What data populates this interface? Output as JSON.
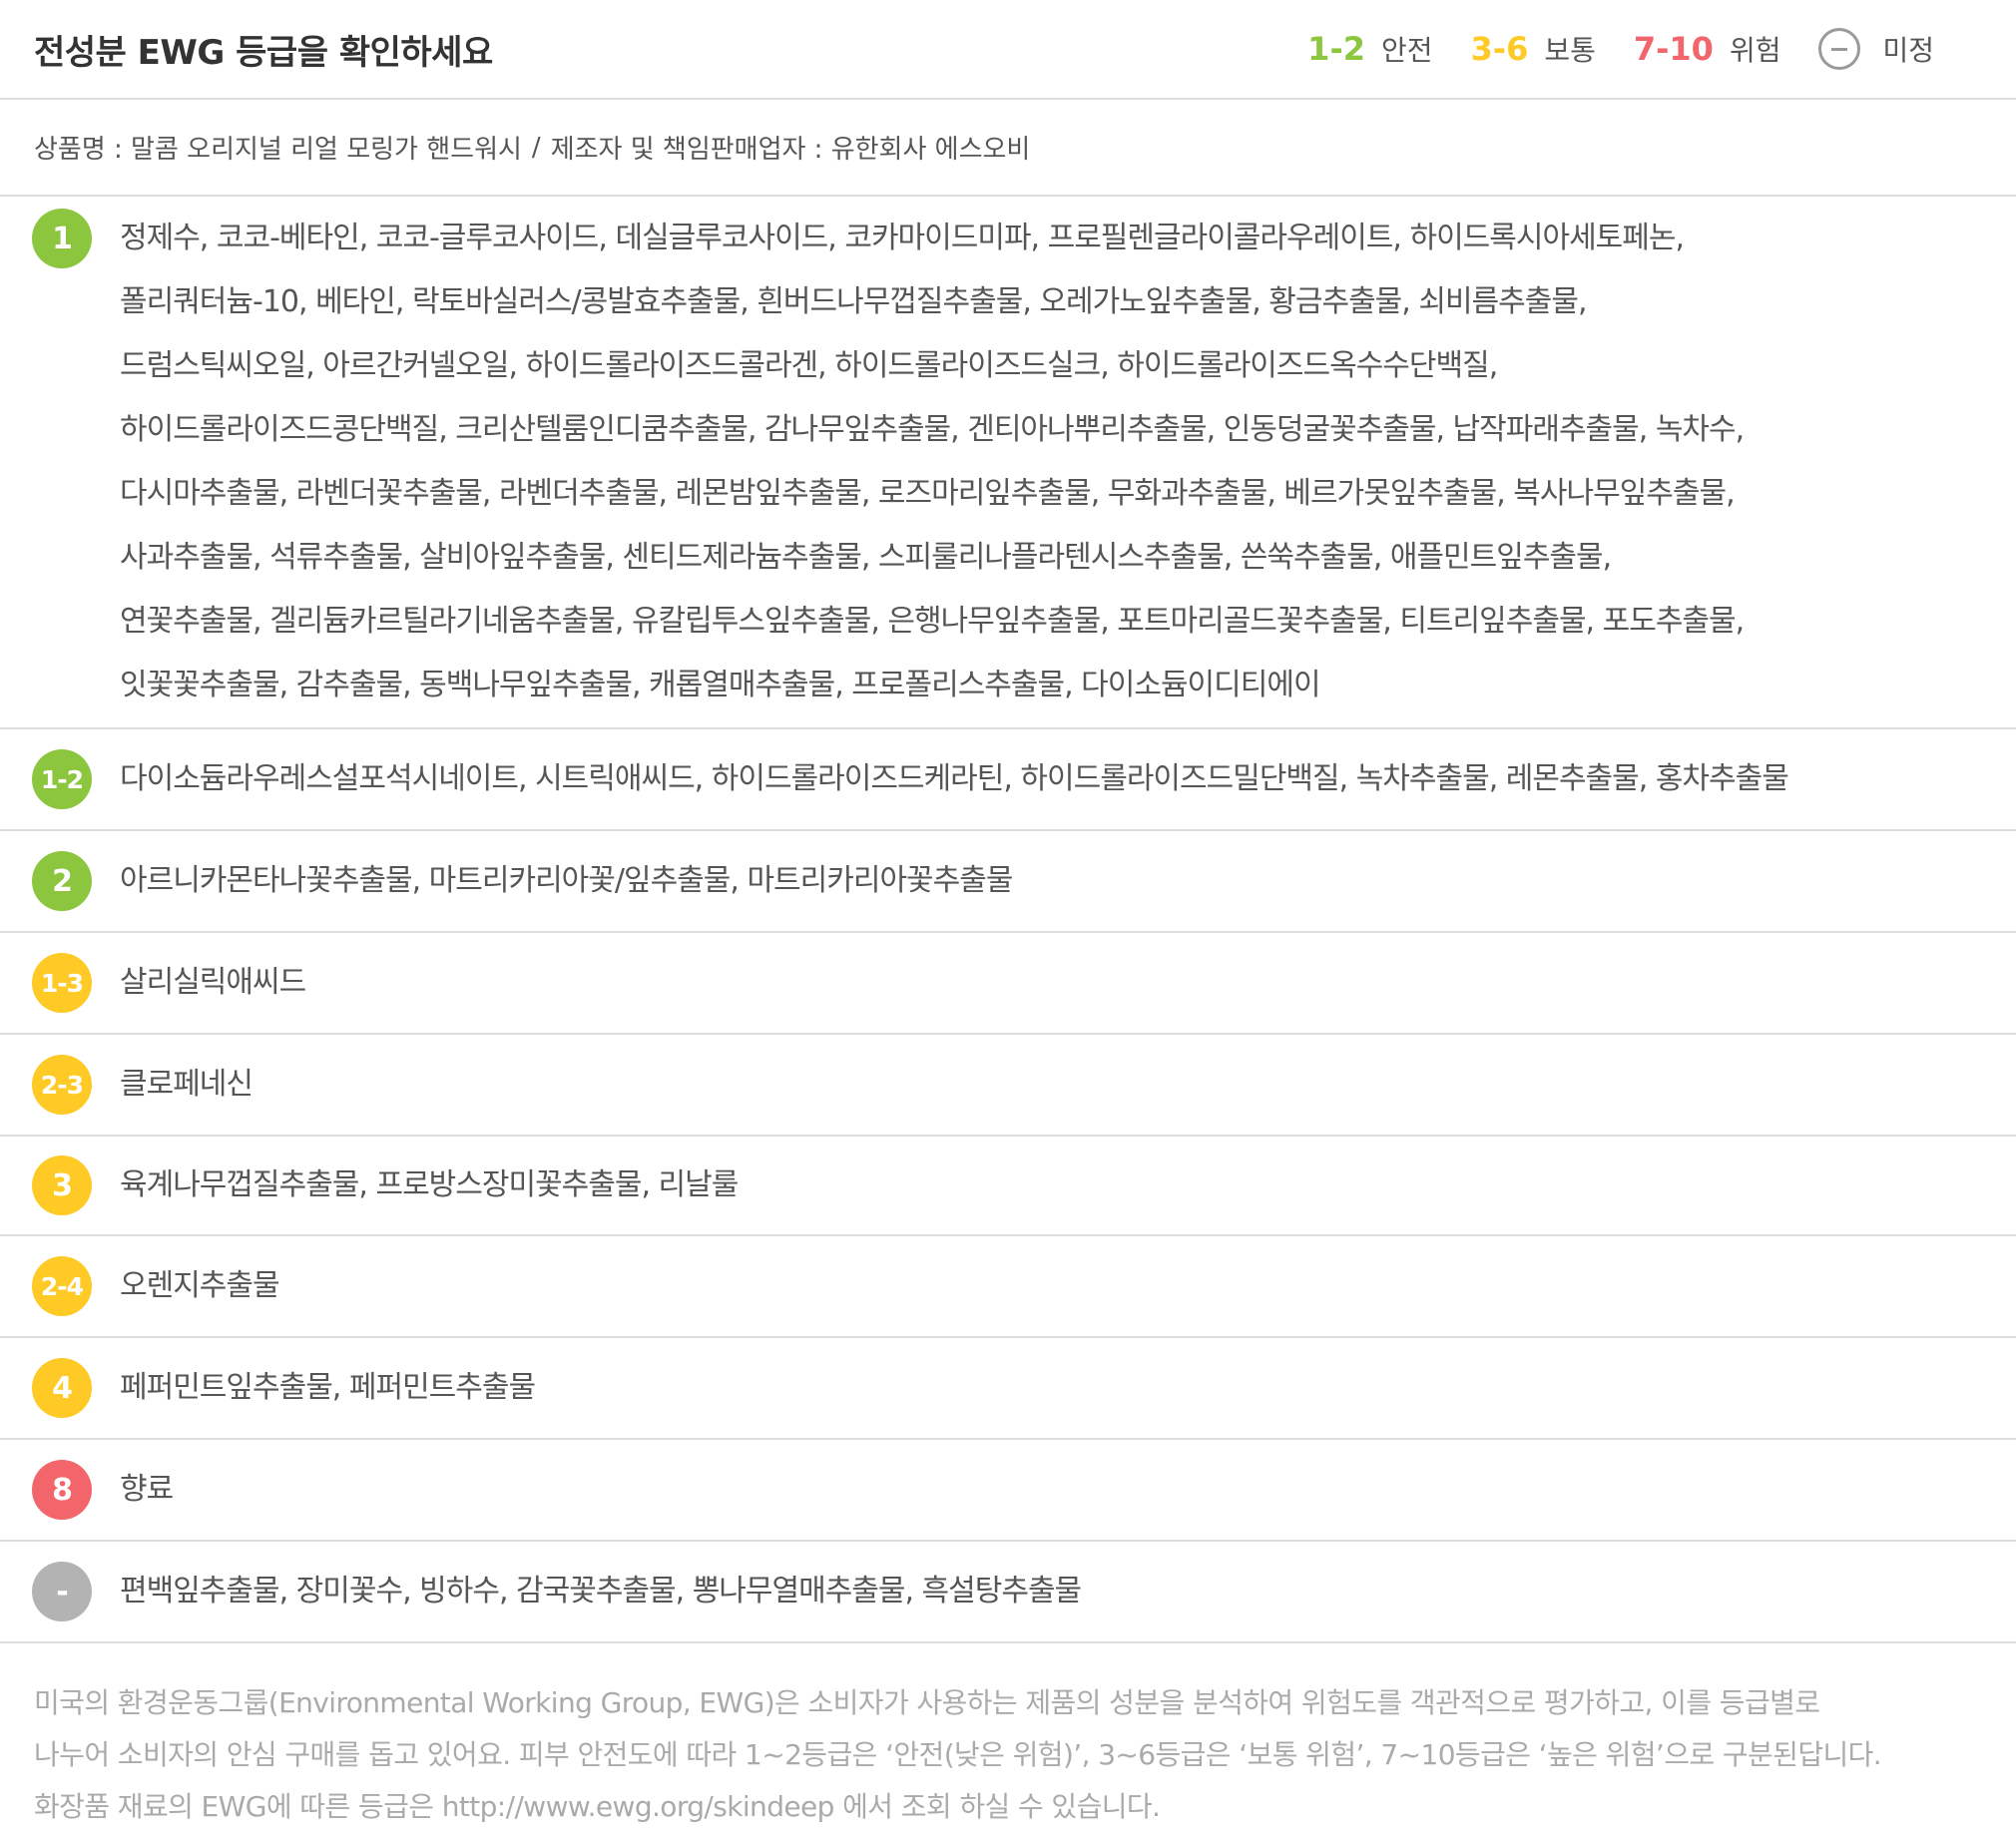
{
  "colors": {
    "safe": "#8cc63f",
    "moderate": "#ffc926",
    "danger": "#f2666b",
    "unknown": "#b3b3b3",
    "text": "#555555",
    "divider": "#dddddd"
  },
  "header": {
    "title": "전성분 EWG 등급을 확인하세요",
    "legend": [
      {
        "range": "1-2",
        "label": "안전"
      },
      {
        "range": "3-6",
        "label": "보통"
      },
      {
        "range": "7-10",
        "label": "위험"
      },
      {
        "label": "미정"
      }
    ]
  },
  "product": {
    "name_label": "상품명 : 말콤 오리지널 리얼 모링가 핸드워시",
    "separator": "/",
    "maker_label": "제조자 및 책임판매업자 : 유한회사 에스오비"
  },
  "rows": [
    {
      "grade": "1",
      "lines": [
        "정제수, 코코-베타인, 코코-글루코사이드, 데실글루코사이드, 코카마이드미파, 프로필렌글라이콜라우레이트, 하이드록시아세토페논,",
        "폴리쿼터늄-10, 베타인, 락토바실러스/콩발효추출물, 흰버드나무껍질추출물, 오레가노잎추출물, 황금추출물, 쇠비름추출물,",
        "드럼스틱씨오일, 아르간커넬오일, 하이드롤라이즈드콜라겐, 하이드롤라이즈드실크, 하이드롤라이즈드옥수수단백질,",
        "하이드롤라이즈드콩단백질, 크리산텔룸인디쿰추출물, 감나무잎추출물, 겐티아나뿌리추출물, 인동덩굴꽃추출물, 납작파래추출물, 녹차수,",
        "다시마추출물, 라벤더꽃추출물, 라벤더추출물, 레몬밤잎추출물, 로즈마리잎추출물, 무화과추출물, 베르가못잎추출물, 복사나무잎추출물,",
        "사과추출물, 석류추출물, 살비아잎추출물, 센티드제라늄추출물, 스피룰리나플라텐시스추출물, 쓴쑥추출물, 애플민트잎추출물,",
        "연꽃추출물, 겔리듐카르틸라기네움추출물, 유칼립투스잎추출물, 은행나무잎추출물, 포트마리골드꽃추출물, 티트리잎추출물, 포도추출물,",
        "잇꽃꽃추출물, 감추출물, 동백나무잎추출물, 캐롭열매추출물, 프로폴리스추출물, 다이소듐이디티에이"
      ]
    },
    {
      "grade": "1-2",
      "text": "다이소듐라우레스설포석시네이트, 시트릭애씨드, 하이드롤라이즈드케라틴, 하이드롤라이즈드밀단백질, 녹차추출물, 레몬추출물, 홍차추출물"
    },
    {
      "grade": "2",
      "text": "아르니카몬타나꽃추출물, 마트리카리아꽃/잎추출물, 마트리카리아꽃추출물"
    },
    {
      "grade": "1-3",
      "text": "살리실릭애씨드"
    },
    {
      "grade": "2-3",
      "text": "클로페네신"
    },
    {
      "grade": "3",
      "text": "육계나무껍질추출물, 프로방스장미꽃추출물, 리날룰"
    },
    {
      "grade": "2-4",
      "text": "오렌지추출물"
    },
    {
      "grade": "4",
      "text": "페퍼민트잎추출물, 페퍼민트추출물"
    },
    {
      "grade": "8",
      "text": "향료"
    },
    {
      "grade": "-",
      "text": "편백잎추출물, 장미꽃수, 빙하수, 감국꽃추출물, 뽕나무열매추출물, 흑설탕추출물"
    }
  ],
  "footer": {
    "lines": [
      "미국의 환경운동그룹(Environmental Working Group, EWG)은 소비자가 사용하는 제품의 성분을 분석하여 위험도를 객관적으로 평가하고, 이를 등급별로",
      "나누어 소비자의 안심 구매를 돕고 있어요. 피부 안전도에 따라 1~2등급은 ‘안전(낮은 위험)’, 3~6등급은 ‘보통 위험’, 7~10등급은 ‘높은 위험’으로 구분된답니다.",
      "화장품 재료의 EWG에 따른 등급은 http://www.ewg.org/skindeep 에서 조회 하실 수 있습니다."
    ]
  }
}
